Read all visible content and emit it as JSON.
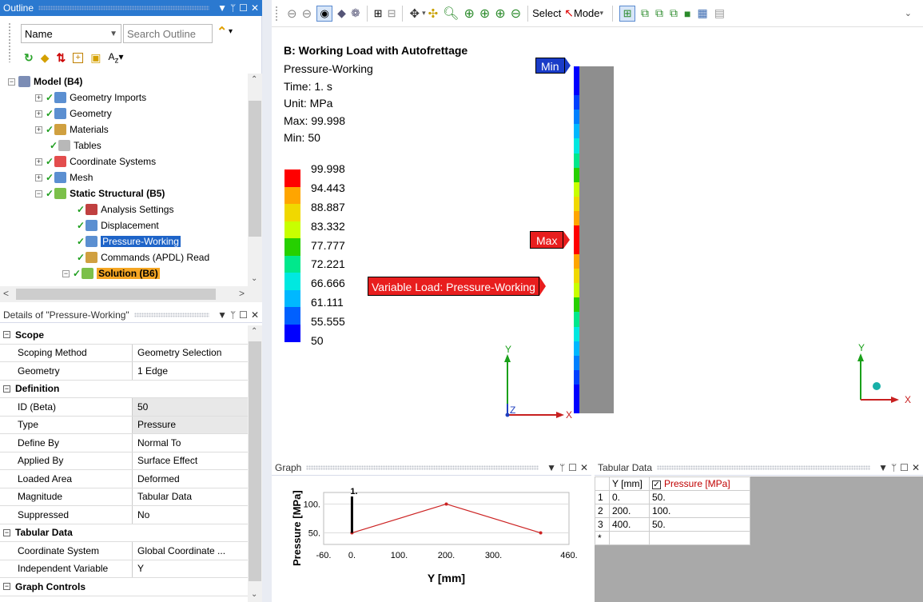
{
  "outline": {
    "title": "Outline",
    "filter_label": "Name",
    "search_placeholder": "Search Outline",
    "tree": [
      {
        "label": "Model (B4)",
        "bold": true
      },
      {
        "label": "Geometry Imports"
      },
      {
        "label": "Geometry"
      },
      {
        "label": "Materials"
      },
      {
        "label": "Tables"
      },
      {
        "label": "Coordinate Systems"
      },
      {
        "label": "Mesh"
      },
      {
        "label": "Static Structural (B5)",
        "bold": true
      },
      {
        "label": "Analysis Settings"
      },
      {
        "label": "Displacement"
      },
      {
        "label": "Pressure-Working",
        "selected": true
      },
      {
        "label": "Commands (APDL) Read"
      },
      {
        "label": "Solution (B6)",
        "bold": true
      }
    ]
  },
  "details": {
    "title": "Details of \"Pressure-Working\"",
    "sections": [
      {
        "type": "header",
        "label": "Scope"
      },
      {
        "key": "Scoping Method",
        "value": "Geometry Selection"
      },
      {
        "key": "Geometry",
        "value": "1 Edge"
      },
      {
        "type": "header",
        "label": "Definition"
      },
      {
        "key": "ID (Beta)",
        "value": "50",
        "shade": true
      },
      {
        "key": "Type",
        "value": "Pressure",
        "shade": true
      },
      {
        "key": "Define By",
        "value": "Normal To"
      },
      {
        "key": "Applied By",
        "value": "Surface Effect"
      },
      {
        "key": "Loaded Area",
        "value": "Deformed"
      },
      {
        "key": "Magnitude",
        "value": "Tabular Data"
      },
      {
        "key": "Suppressed",
        "value": "No"
      },
      {
        "type": "header",
        "label": "Tabular Data"
      },
      {
        "key": "Coordinate System",
        "value": "Global Coordinate ..."
      },
      {
        "key": "Independent Variable",
        "value": "Y"
      },
      {
        "type": "header",
        "label": "Graph Controls"
      }
    ]
  },
  "toolbar": {
    "select_label": "Select",
    "mode_label": "Mode"
  },
  "viewport": {
    "title": "B: Working Load with Autofrettage",
    "lines": [
      "Pressure-Working",
      "Time: 1. s",
      "Unit: MPa",
      "Max: 99.998",
      "Min: 50"
    ],
    "legend_values": [
      "99.998",
      "94.443",
      "88.887",
      "83.332",
      "77.777",
      "72.221",
      "66.666",
      "61.111",
      "55.555",
      "50"
    ],
    "legend_colors": [
      "#ff0000",
      "#ffa500",
      "#f0d800",
      "#c8ff00",
      "#26d000",
      "#00e88c",
      "#00e8e0",
      "#00b8ff",
      "#0060ff",
      "#0000ff"
    ],
    "min_tag": "Min",
    "max_tag": "Max",
    "variable_tag": "Variable Load: Pressure-Working",
    "axis_x": "X",
    "axis_y": "Y",
    "axis_z": "Z"
  },
  "graph": {
    "title": "Graph",
    "step_label": "1.",
    "ylabel": "Pressure [MPa]",
    "xlabel": "Y [mm]",
    "x_ticks": [
      "-60.",
      "0.",
      "100.",
      "200.",
      "300.",
      "460."
    ],
    "y_ticks": [
      "100.",
      "50."
    ]
  },
  "chart_data": {
    "type": "line",
    "x": [
      0,
      200,
      400
    ],
    "values": [
      50,
      100,
      50
    ],
    "xlabel": "Y [mm]",
    "ylabel": "Pressure [MPa]",
    "xlim": [
      -60,
      460
    ],
    "ylim": [
      30,
      120
    ]
  },
  "tabular": {
    "title": "Tabular Data",
    "col1": "Y [mm]",
    "col2": "Pressure [MPa]",
    "rows": [
      {
        "n": "1",
        "y": "0.",
        "p": "50."
      },
      {
        "n": "2",
        "y": "200.",
        "p": "100."
      },
      {
        "n": "3",
        "y": "400.",
        "p": "50."
      }
    ],
    "new_row": "*"
  }
}
